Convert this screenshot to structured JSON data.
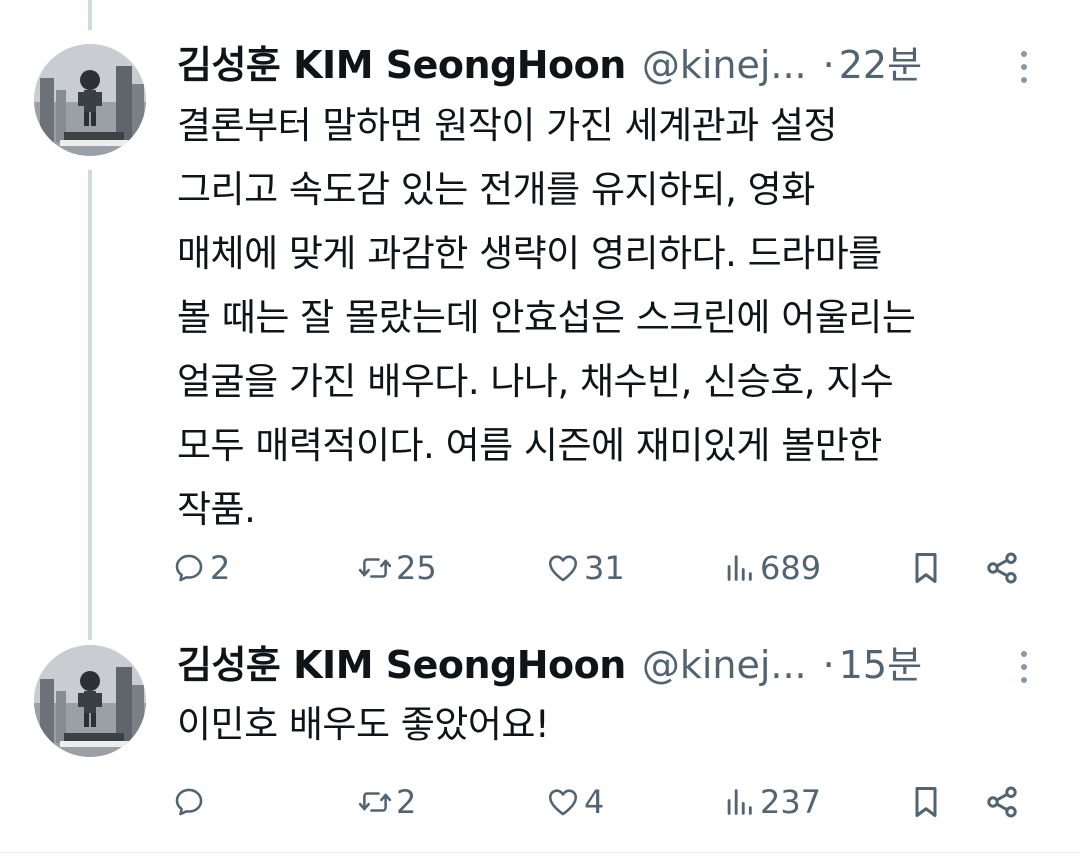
{
  "tweets": [
    {
      "name": "김성훈 KIM SeongHoon",
      "handle": "@kinej...",
      "dot": "·",
      "time": "22분",
      "text": "결론부터 말하면 원작이 가진 세계관과 설정\n그리고 속도감 있는 전개를 유지하되, 영화\n매체에 맞게 과감한 생략이 영리하다. 드라마를\n볼 때는 잘 몰랐는데 안효섭은 스크린에 어울리는\n얼굴을 가진 배우다. 나나, 채수빈, 신승호, 지수\n모두 매력적이다. 여름 시즌에 재미있게 볼만한\n작품.",
      "replies": "2",
      "reposts": "25",
      "likes": "31",
      "views": "689"
    },
    {
      "name": "김성훈 KIM SeongHoon",
      "handle": "@kinej...",
      "dot": "·",
      "time": "15분",
      "text": "이민호 배우도 좋았어요!",
      "replies": "",
      "reposts": "2",
      "likes": "4",
      "views": "237"
    }
  ],
  "icons": {
    "reply": "reply-icon",
    "repost": "repost-icon",
    "like": "like-icon",
    "views": "views-icon",
    "bookmark": "bookmark-icon",
    "share": "share-icon",
    "more": "more-icon"
  },
  "colors": {
    "text": "#0f1419",
    "secondary": "#536471",
    "thread_line": "#cfd9de"
  }
}
